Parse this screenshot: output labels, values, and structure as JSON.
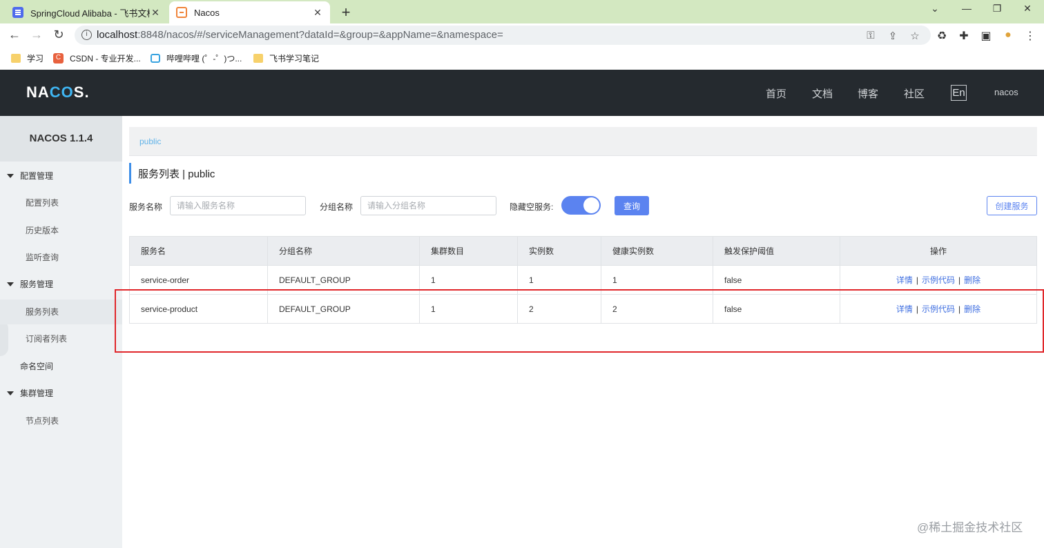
{
  "browser": {
    "tabs": [
      {
        "title": "SpringCloud Alibaba - 飞书文档",
        "active": false
      },
      {
        "title": "Nacos",
        "active": true
      }
    ],
    "new_tab_label": "+",
    "window_controls": {
      "minimize": "⌄",
      "minimize2": "—",
      "restore": "❐",
      "close": "✕"
    },
    "nav": {
      "back": "←",
      "forward": "→",
      "reload": "↻"
    },
    "url_host": "localhost",
    "url_rest": ":8848/nacos/#/serviceManagement?dataId=&group=&appName=&namespace=",
    "bookmarks": [
      "学习",
      "CSDN - 专业开发...",
      "哔哩哔哩 (゜-゜)つ...",
      "飞书学习笔记"
    ]
  },
  "header": {
    "logo_prefix": "NA",
    "logo_mid": "CO",
    "logo_suffix": "S.",
    "nav": [
      "首页",
      "文档",
      "博客",
      "社区"
    ],
    "lang": "En",
    "user": "nacos"
  },
  "sidebar": {
    "title": "NACOS 1.1.4",
    "items": [
      {
        "label": "配置管理",
        "type": "group"
      },
      {
        "label": "配置列表",
        "type": "sub"
      },
      {
        "label": "历史版本",
        "type": "sub"
      },
      {
        "label": "监听查询",
        "type": "sub"
      },
      {
        "label": "服务管理",
        "type": "group"
      },
      {
        "label": "服务列表",
        "type": "sub",
        "selected": true
      },
      {
        "label": "订阅者列表",
        "type": "sub"
      },
      {
        "label": "命名空间",
        "type": "plain"
      },
      {
        "label": "集群管理",
        "type": "group"
      },
      {
        "label": "节点列表",
        "type": "sub"
      }
    ]
  },
  "main": {
    "breadcrumb": "public",
    "page_title": "服务列表  |  public",
    "form": {
      "service_name_label": "服务名称",
      "service_name_placeholder": "请输入服务名称",
      "group_name_label": "分组名称",
      "group_name_placeholder": "请输入分组名称",
      "hide_empty_label": "隐藏空服务:",
      "hide_empty_on": true,
      "query_button": "查询",
      "create_button": "创建服务"
    },
    "table": {
      "columns": [
        "服务名",
        "分组名称",
        "集群数目",
        "实例数",
        "健康实例数",
        "触发保护阈值",
        "操作"
      ],
      "rows": [
        [
          "service-order",
          "DEFAULT_GROUP",
          "1",
          "1",
          "1",
          "false"
        ],
        [
          "service-product",
          "DEFAULT_GROUP",
          "1",
          "2",
          "2",
          "false"
        ]
      ],
      "actions": [
        "详情",
        "示例代码",
        "删除"
      ],
      "action_sep": "|"
    }
  },
  "watermark": "@稀土掘金技术社区",
  "colors": {
    "accent": "#5b83f0",
    "header_bg": "#252a2f",
    "highlight": "#e0262a",
    "link": "#3e6ee0"
  }
}
